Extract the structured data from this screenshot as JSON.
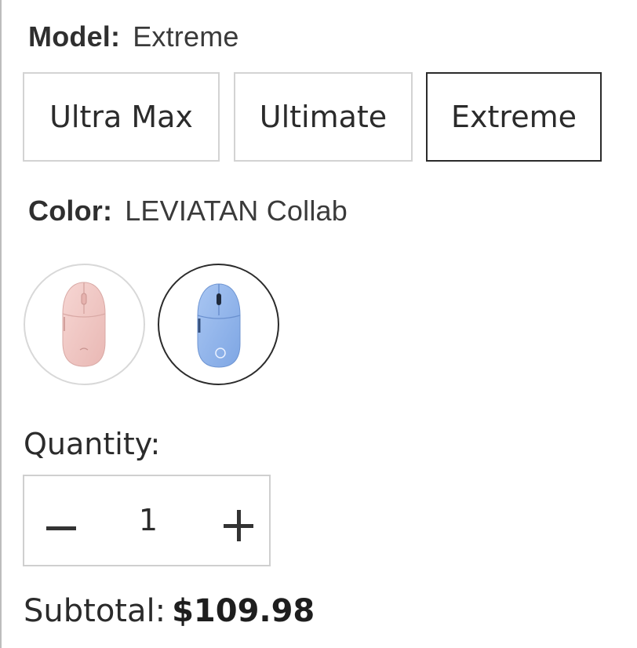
{
  "model": {
    "label": "Model:",
    "selected": "Extreme",
    "options": [
      "Ultra Max",
      "Ultimate",
      "Extreme"
    ],
    "selected_index": 2
  },
  "color": {
    "label": "Color:",
    "selected": "LEVIATAN Collab",
    "swatches": [
      {
        "icon": "pink-mouse-icon",
        "fill": "#f2c9c6",
        "selected": false
      },
      {
        "icon": "blue-mouse-icon",
        "fill": "#8fb4ea",
        "selected": true
      }
    ]
  },
  "quantity": {
    "label": "Quantity:",
    "value": "1",
    "minus_icon": "minus-icon",
    "plus_icon": "plus-icon"
  },
  "subtotal": {
    "label": "Subtotal:",
    "value": "$109.98"
  },
  "colors": {
    "selected_border": "#2b2b2b",
    "unselected_border": "#d3d3d3"
  }
}
